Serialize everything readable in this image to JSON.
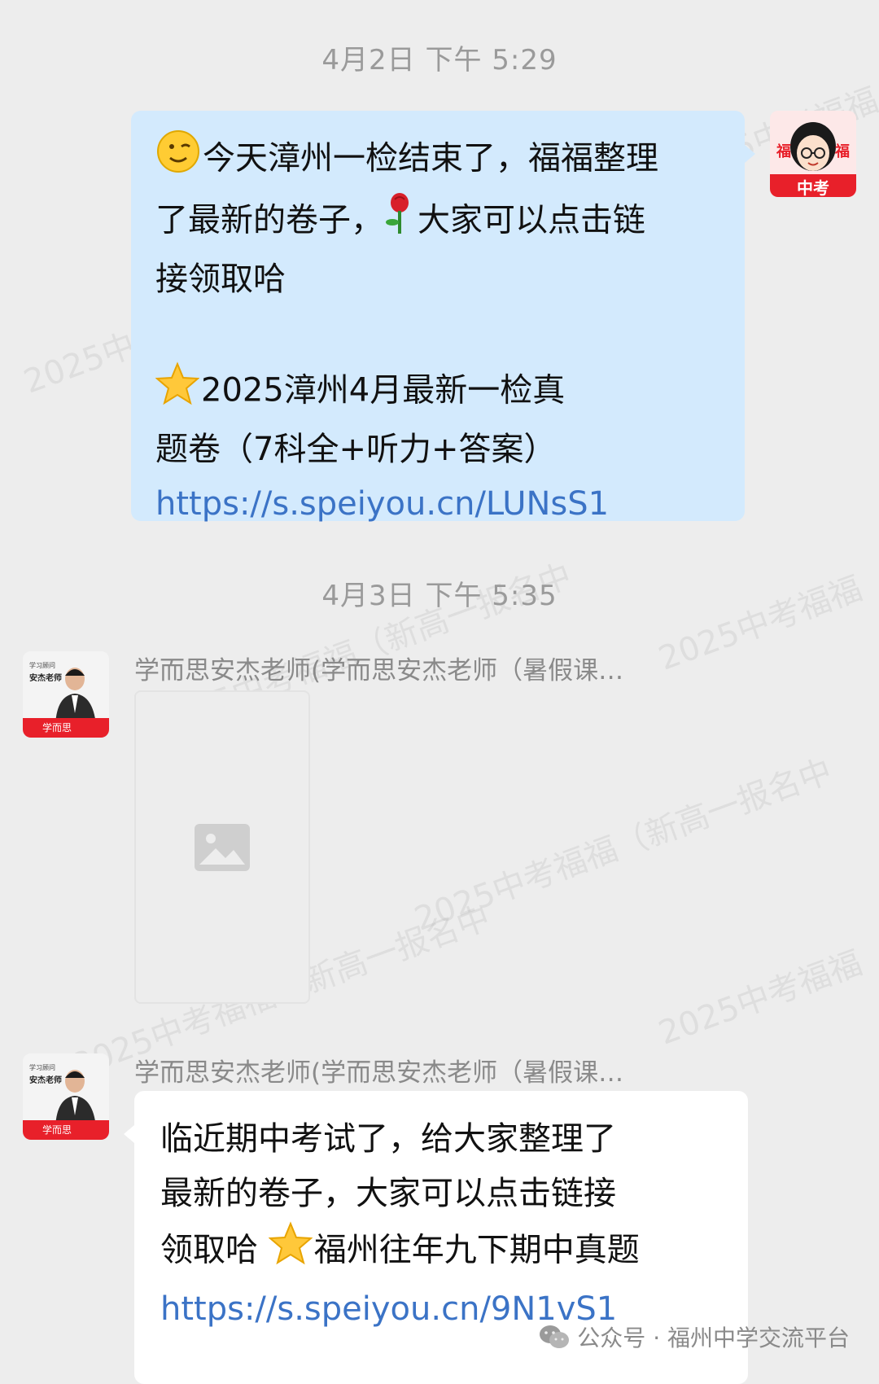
{
  "chat": {
    "timestamp_1": "4月2日  下午 5:29",
    "timestamp_2": "4月3日  下午 5:35",
    "msg1": {
      "line1": "今天漳州一检结束了，福福整理",
      "line2a": "了最新的卷子，",
      "line2b": "大家可以点击链",
      "line3": "接领取哈",
      "line5": "2025漳州4月最新一检真",
      "line6": "题卷（7科全+听力+答案）",
      "link": "https://s.speiyou.cn/LUNsS1"
    },
    "avatar_right": {
      "left_label": "福",
      "right_label": "福",
      "badge": "中考"
    },
    "teacher_avatar": {
      "top_label": "学习顾问",
      "name_label": "安杰老师",
      "brand": "学而思"
    },
    "sender_name": "学而思安杰老师(学而思安杰老师（暑假课…",
    "msg3": {
      "line1": "临近期中考试了，给大家整理了",
      "line2": "最新的卷子，大家可以点击链接",
      "line3a": "领取哈",
      "line3b": "福州往年九下期中真题",
      "link": "https://s.speiyou.cn/9N1vS1"
    }
  },
  "watermark_text": "2025中考福福（新高一报名中",
  "footer": {
    "text": "公众号 · 福州中学交流平台",
    "icon": "wechat-icon"
  },
  "colors": {
    "background": "#ededed",
    "bubble_right": "#d3eafd",
    "bubble_left": "#ffffff",
    "link": "#3b73c6",
    "brand_red": "#e8202a"
  }
}
